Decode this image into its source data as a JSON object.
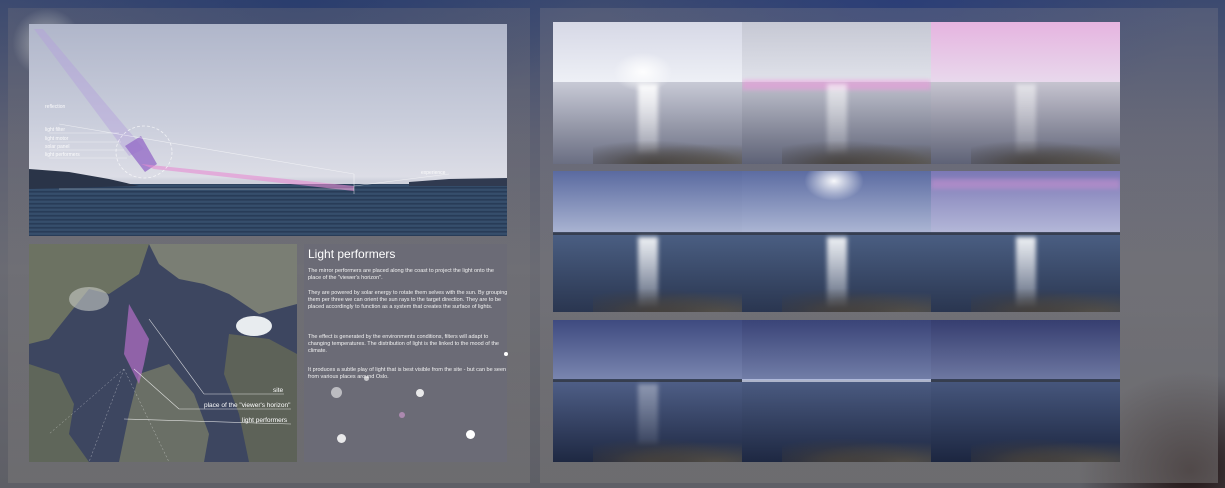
{
  "diagram": {
    "labels": {
      "reflection": "reflection",
      "light_filter": "light filter",
      "light_motor": "light motor",
      "solar_panel": "solar panel",
      "light_performers": "light performers",
      "experience": "experience"
    }
  },
  "map": {
    "labels": {
      "site": "site",
      "viewers_horizon": "place of the \"viewer's horizon\"",
      "light_performers": "light performers"
    }
  },
  "text_panel": {
    "title": "Light performers",
    "paragraphs": [
      "The mirror performers are placed along the coast to project the light onto the place of the \"viewer's horizon\".",
      "They are powered by solar energy to rotate them selves with the sun. By grouping them per three we can orient the sun rays to the target direction. They are to be placed accordingly to function as a system that creates the surface of lights.",
      "The effect is generated by the environments conditions, filters will adapt to changing temperatures. The distribution of light is the linked to the mood of the climate.",
      "It produces a subtle play of light that is best visible from the site - but can be seen from various places around Oslo."
    ]
  },
  "colors": {
    "accent_pink": "#e07ad0",
    "dot_white": "#ffffff",
    "sea_dark": "#223450"
  }
}
